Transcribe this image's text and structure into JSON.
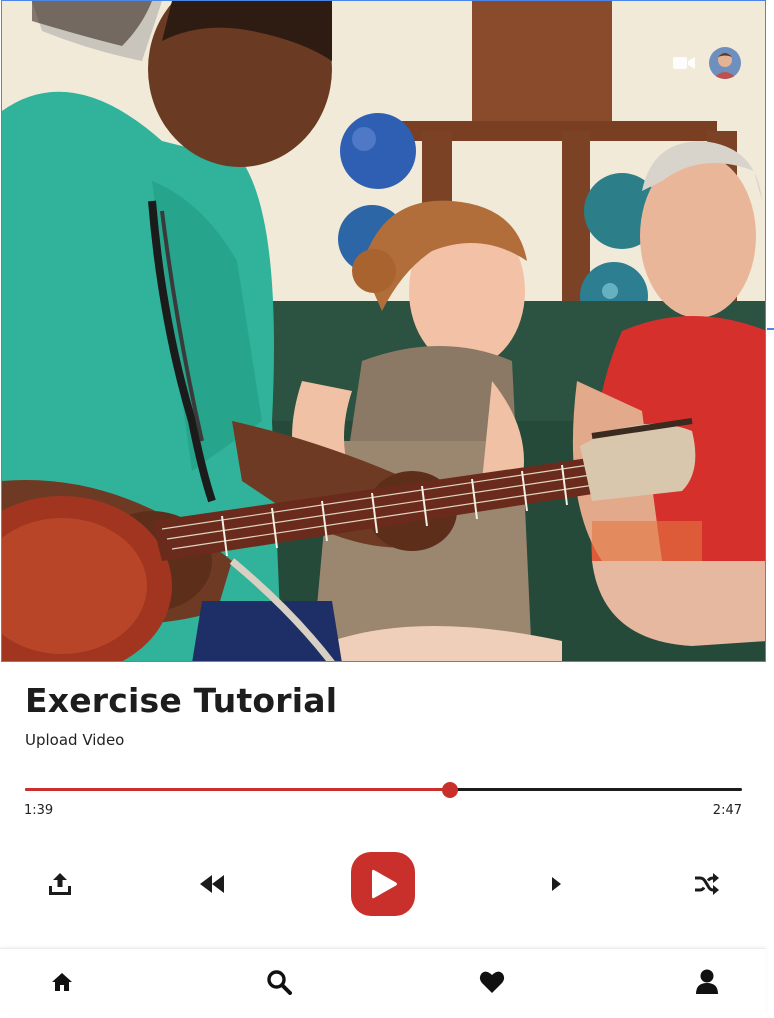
{
  "hero": {
    "video_icon": "video-camera-icon",
    "avatar": "user-avatar"
  },
  "track": {
    "title": "Exercise Tutorial",
    "subtitle": "Upload Video",
    "current_time": "1:39",
    "total_time": "2:47",
    "progress": 0.593
  },
  "controls": {
    "upload_icon": "upload-icon",
    "rewind_icon": "rewind-icon",
    "play_icon": "play-icon",
    "next_icon": "next-icon",
    "shuffle_icon": "shuffle-icon"
  },
  "nav": {
    "items": [
      "home-icon",
      "search-icon",
      "heart-icon",
      "profile-icon"
    ]
  },
  "colors": {
    "accent": "#c9302c",
    "text": "#1d1d1d",
    "track": "#1c1c1c"
  }
}
